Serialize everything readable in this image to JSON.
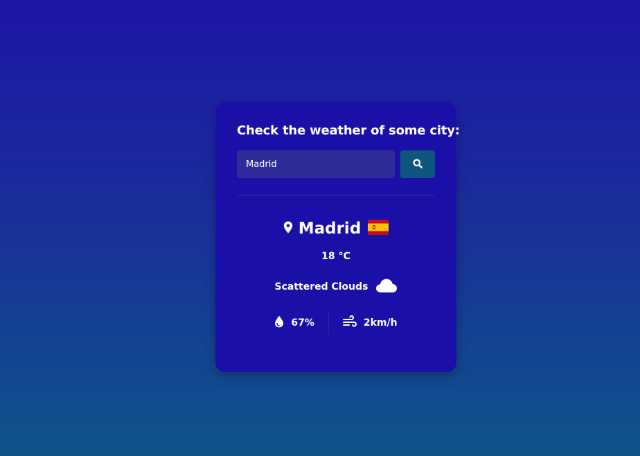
{
  "card": {
    "heading": "Check the weather of some city:",
    "search": {
      "value": "Madrid",
      "button_icon": "search-icon"
    }
  },
  "weather": {
    "city": "Madrid",
    "country_flag": "spain-flag",
    "temperature": "18",
    "temperature_unit": "°C",
    "description": "Scattered Clouds",
    "description_icon": "cloud-icon",
    "humidity": "67%",
    "humidity_icon": "water-drop-icon",
    "wind": "2km/h",
    "wind_icon": "wind-icon"
  },
  "colors": {
    "card_background": "#1a10a8",
    "input_background": "#2e2c98",
    "button_background": "#0e5580",
    "page_gradient_top": "#1c16a6",
    "page_gradient_bottom": "#0e548a"
  }
}
